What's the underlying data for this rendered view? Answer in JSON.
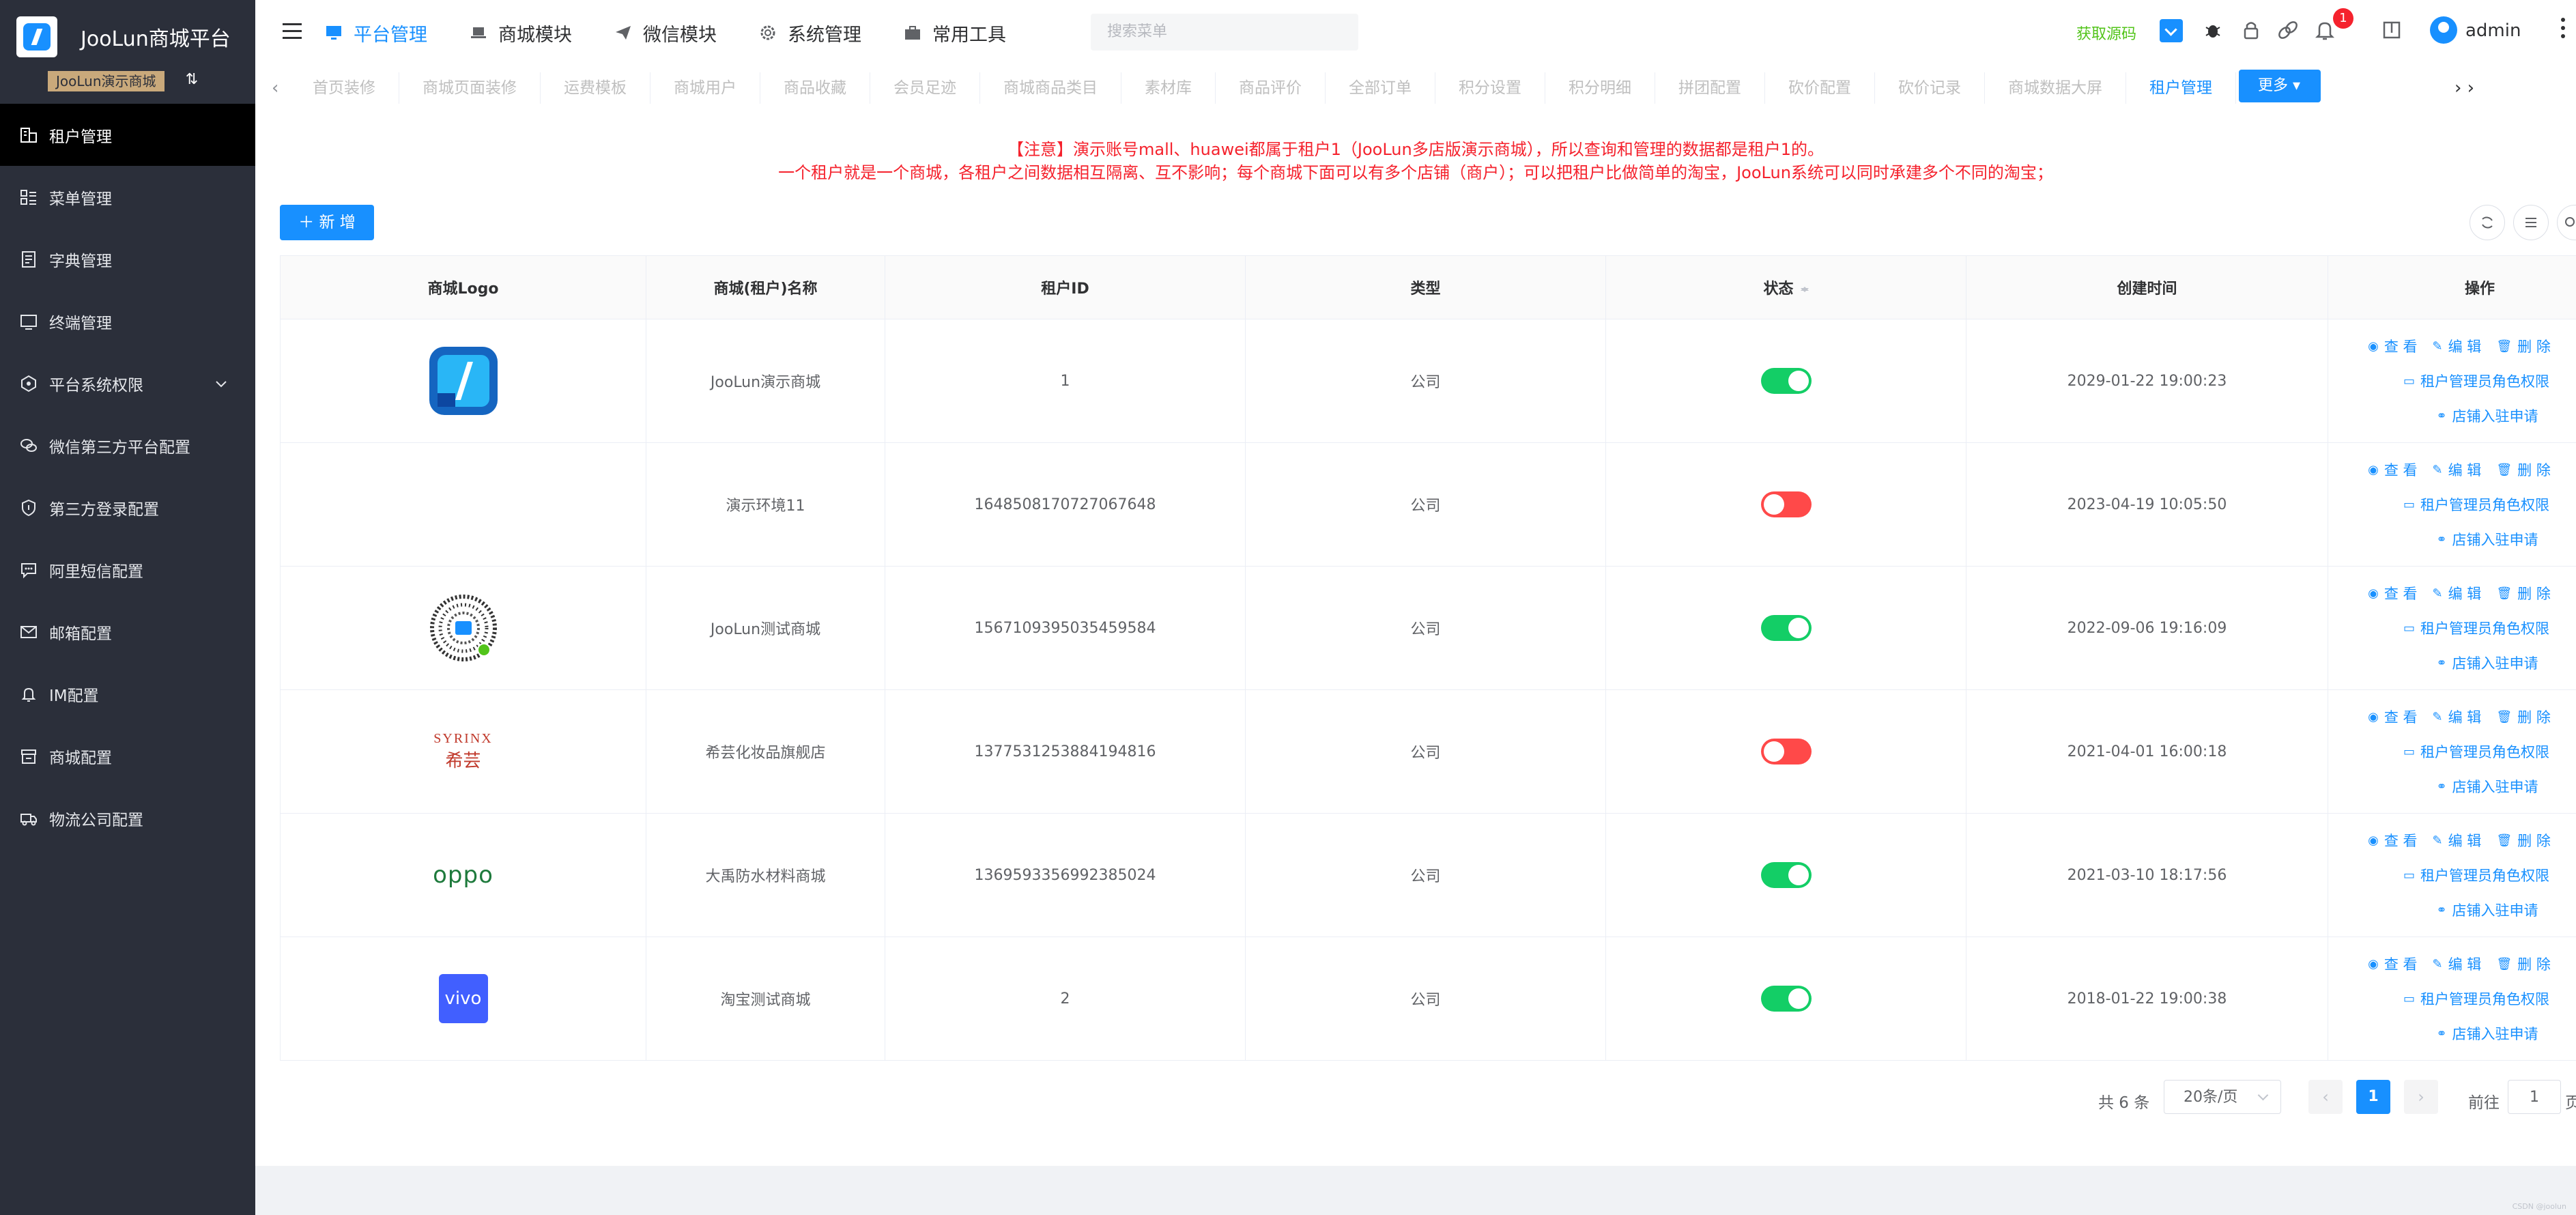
{
  "brand": {
    "title": "JooLun商城平台",
    "tenant": "JooLun演示商城"
  },
  "sidebar": {
    "items": [
      {
        "label": "租户管理",
        "icon": "tenant-building-icon",
        "active": true
      },
      {
        "label": "菜单管理",
        "icon": "menu-list-icon"
      },
      {
        "label": "字典管理",
        "icon": "dictionary-icon"
      },
      {
        "label": "终端管理",
        "icon": "terminal-icon"
      },
      {
        "label": "平台系统权限",
        "icon": "permission-icon",
        "expandable": true
      },
      {
        "label": "微信第三方平台配置",
        "icon": "wechat-icon"
      },
      {
        "label": "第三方登录配置",
        "icon": "shield-icon"
      },
      {
        "label": "阿里短信配置",
        "icon": "sms-icon"
      },
      {
        "label": "邮箱配置",
        "icon": "mail-icon"
      },
      {
        "label": "IM配置",
        "icon": "bell-icon"
      },
      {
        "label": "商城配置",
        "icon": "shop-icon"
      },
      {
        "label": "物流公司配置",
        "icon": "truck-icon"
      }
    ]
  },
  "topnav": {
    "items": [
      {
        "label": "平台管理",
        "active": true
      },
      {
        "label": "商城模块"
      },
      {
        "label": "微信模块"
      },
      {
        "label": "系统管理"
      },
      {
        "label": "常用工具"
      }
    ],
    "search_placeholder": "搜索菜单",
    "get_source": "获取源码",
    "notification_count": "1",
    "user": "admin"
  },
  "tabs": {
    "items": [
      "首页装修",
      "商城页面装修",
      "运费模板",
      "商城用户",
      "商品收藏",
      "会员足迹",
      "商城商品类目",
      "素材库",
      "商品评价",
      "全部订单",
      "积分设置",
      "积分明细",
      "拼团配置",
      "砍价配置",
      "砍价记录",
      "商城数据大屏",
      "租户管理"
    ],
    "active_index": 16,
    "more": "更多"
  },
  "notice": {
    "line1": "【注意】演示账号mall、huawei都属于租户1（JooLun多店版演示商城），所以查询和管理的数据都是租户1的。",
    "line2": "一个租户就是一个商城，各租户之间数据相互隔离、互不影响；每个商城下面可以有多个店铺（商户）；可以把租户比做简单的淘宝，JooLun系统可以同时承建多个不同的淘宝；"
  },
  "toolbar": {
    "add": "新 增"
  },
  "table": {
    "headers": [
      "商城Logo",
      "商城(租户)名称",
      "租户ID",
      "类型",
      "状态",
      "创建时间",
      "操作"
    ],
    "ops": {
      "view": "查 看",
      "edit": "编 辑",
      "delete": "删 除",
      "role": "租户管理员角色权限",
      "apply": "店铺入驻申请"
    },
    "rows": [
      {
        "logo": "joolun-logo",
        "name": "JooLun演示商城",
        "id": "1",
        "type": "公司",
        "status": "on",
        "created": "2029-01-22 19:00:23"
      },
      {
        "logo": "",
        "name": "演示环境11",
        "id": "1648508170727067648",
        "type": "公司",
        "status": "off",
        "created": "2023-04-19 10:05:50"
      },
      {
        "logo": "qrcode-logo",
        "name": "JooLun测试商城",
        "id": "1567109395035459584",
        "type": "公司",
        "status": "on",
        "created": "2022-09-06 19:16:09"
      },
      {
        "logo": "syrinx-logo",
        "logo_text": "SYRINX",
        "logo_sub": "希芸",
        "name": "希芸化妆品旗舰店",
        "id": "1377531253884194816",
        "type": "公司",
        "status": "off",
        "created": "2021-04-01 16:00:18"
      },
      {
        "logo": "oppo-logo",
        "logo_text": "oppo",
        "name": "大禹防水材料商城",
        "id": "1369593356992385024",
        "type": "公司",
        "status": "on",
        "created": "2021-03-10 18:17:56"
      },
      {
        "logo": "vivo-logo",
        "logo_text": "vivo",
        "name": "淘宝测试商城",
        "id": "2",
        "type": "公司",
        "status": "on",
        "created": "2018-01-22 19:00:38"
      }
    ]
  },
  "pagination": {
    "total": "共 6 条",
    "page_size": "20条/页",
    "current": "1",
    "goto_label": "前往",
    "goto_value": "1",
    "goto_tail": "页"
  },
  "watermark": "CSDN @joolun",
  "colors": {
    "primary": "#1890ff",
    "sidebar": "#2b2f3a",
    "danger": "#f5222d",
    "success": "#13ce66",
    "badge": "#c9a97b"
  }
}
